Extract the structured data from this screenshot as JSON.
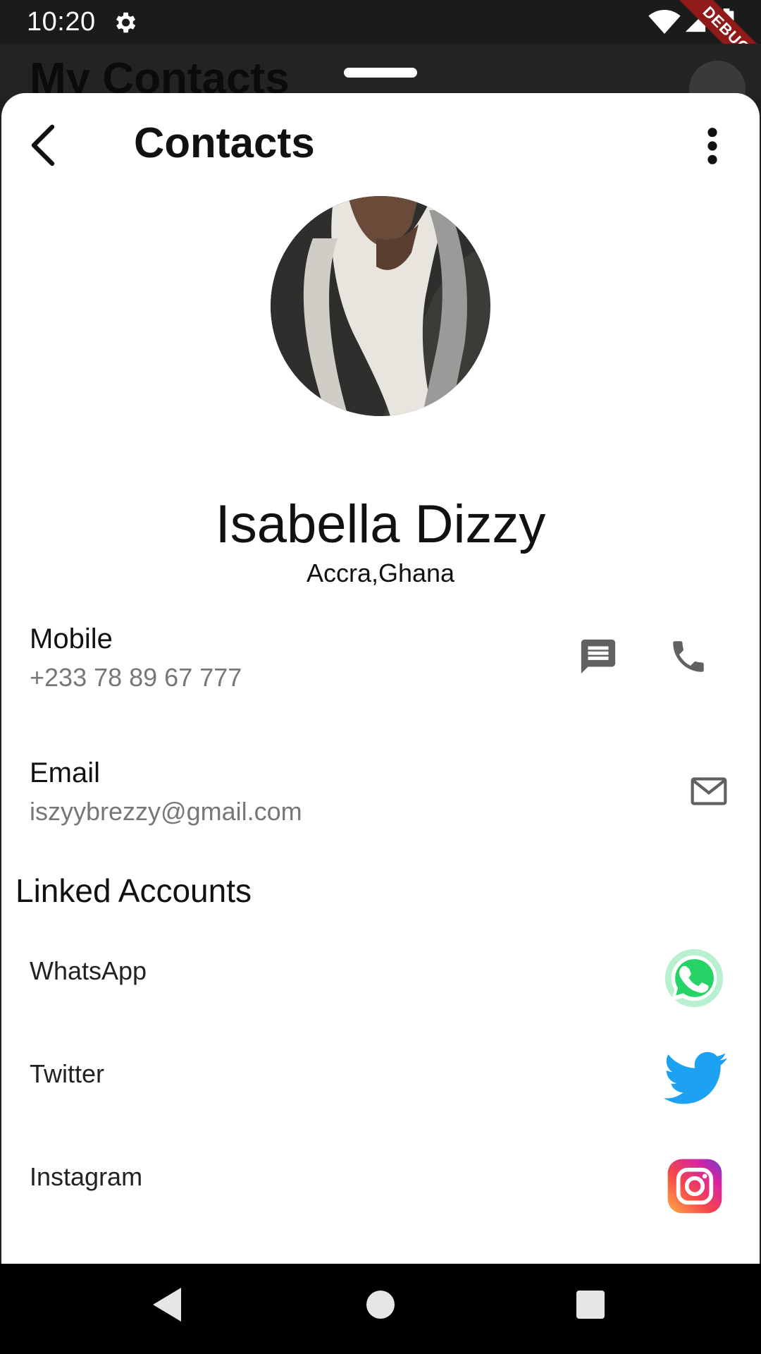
{
  "status_bar": {
    "time": "10:20",
    "debug_label": "DEBUG"
  },
  "background_screen": {
    "title": "My Contacts"
  },
  "header": {
    "title": "Contacts"
  },
  "profile": {
    "name": "Isabella Dizzy",
    "location": "Accra,Ghana"
  },
  "mobile": {
    "label": "Mobile",
    "value": "+233 78 89 67 777"
  },
  "email": {
    "label": "Email",
    "value": "iszyybrezzy@gmail.com"
  },
  "linked_accounts": {
    "title": "Linked Accounts",
    "items": [
      {
        "label": "WhatsApp",
        "icon": "whatsapp-icon",
        "color": "#25D366"
      },
      {
        "label": "Twitter",
        "icon": "twitter-icon",
        "color": "#1DA1F2"
      },
      {
        "label": "Instagram",
        "icon": "instagram-icon",
        "color": "#E1306C"
      }
    ]
  },
  "colors": {
    "icon_gray": "#616161",
    "sheet_bg": "#ffffff",
    "debug_red": "#8e1a1a"
  }
}
